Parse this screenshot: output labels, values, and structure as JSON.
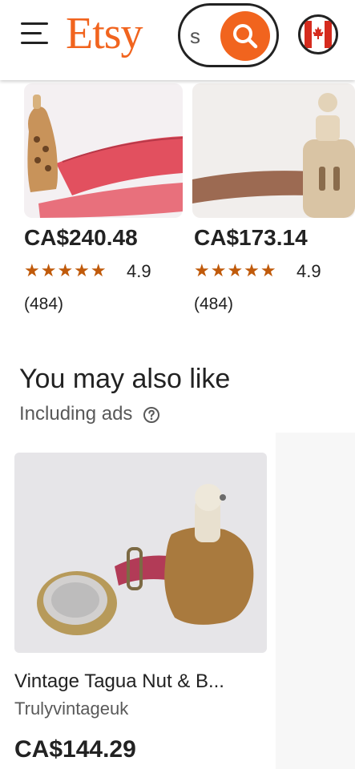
{
  "header": {
    "logo": "Etsy",
    "search_value": "s",
    "colors": {
      "brand": "#F1641E",
      "ink": "#222222"
    },
    "icons": [
      "menu-icon",
      "search-icon",
      "canada-flag-icon"
    ]
  },
  "top_listings": [
    {
      "price": "CA$240.48",
      "stars": "★★★★★",
      "rating": "4.9",
      "review_count": "(484)"
    },
    {
      "price": "CA$173.14",
      "stars": "★★★★★",
      "rating": "4.9",
      "review_count": "(484)"
    }
  ],
  "recommendations": {
    "title": "You may also like",
    "subtitle": "Including ads",
    "items": [
      {
        "title": "Vintage Tagua Nut & B...",
        "shop": "Trulyvintageuk",
        "price": "CA$144.29"
      }
    ]
  }
}
